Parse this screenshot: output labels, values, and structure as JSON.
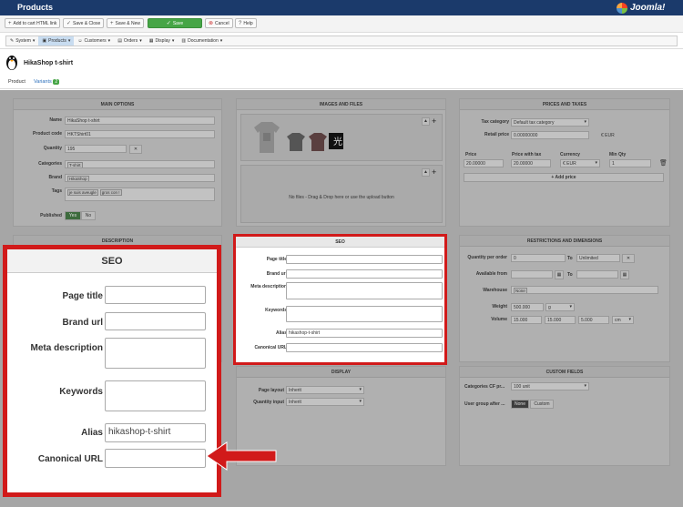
{
  "app": {
    "title": "Products",
    "brand": "Joomla!"
  },
  "toolbar": {
    "add_cart_link": "Add to cart HTML link",
    "save_close": "Save & Close",
    "save_new": "Save & New",
    "save": "Save",
    "cancel": "Cancel",
    "help": "Help"
  },
  "menu": [
    "System",
    "Products",
    "Customers",
    "Orders",
    "Display",
    "Documentation"
  ],
  "product": {
    "name": "HikaShop t-shirt"
  },
  "tabs": {
    "product": "Product",
    "variants": "Variants",
    "variants_count": "2"
  },
  "main_options": {
    "heading": "MAIN OPTIONS",
    "name_label": "Name",
    "name_value": "HikaShop t-shirt",
    "code_label": "Product code",
    "code_value": "HKTShirt01",
    "quantity_label": "Quantity",
    "quantity_value": "195",
    "categories_label": "Categories",
    "categories_tag": "T-shirt",
    "brand_label": "Brand",
    "brand_tag": "HikaShop",
    "tags_label": "Tags",
    "tag1": "je suis aveugle",
    "tag2": "gros con !",
    "published_label": "Published",
    "yes": "Yes",
    "no": "No"
  },
  "images": {
    "heading": "IMAGES AND FILES",
    "no_files": "No files - Drag & Drop here or use the upload button"
  },
  "prices": {
    "heading": "PRICES AND TAXES",
    "tax_label": "Tax category",
    "tax_value": "Default tax category",
    "retail_label": "Retail price",
    "retail_value": "0.00000000",
    "retail_currency": "€ EUR",
    "col_price": "Price",
    "col_price_tax": "Price with tax",
    "col_currency": "Currency",
    "col_min_qty": "Min Qty",
    "price_value": "20.00000",
    "price_tax_value": "20.00000",
    "currency_value": "€ EUR",
    "min_qty_value": "1",
    "add_price": "Add price"
  },
  "description": {
    "heading": "DESCRIPTION"
  },
  "restrictions": {
    "heading": "RESTRICTIONS AND DIMENSIONS",
    "qpo_label": "Quantity per order",
    "qpo_from": "0",
    "qpo_to_label": "To",
    "qpo_to": "Unlimited",
    "avail_label": "Available from",
    "to_label": "To",
    "warehouse_label": "Warehouse",
    "warehouse_tag": "None",
    "weight_label": "Weight",
    "weight_value": "500.000",
    "weight_unit": "g",
    "volume_label": "Volume",
    "v1": "15.000",
    "v2": "15.000",
    "v3": "5.000",
    "volume_unit": "cm"
  },
  "seo": {
    "heading": "SEO",
    "page_title": "Page title",
    "brand_url": "Brand url",
    "meta_description": "Meta description",
    "keywords": "Keywords",
    "alias": "Alias",
    "alias_value": "hikashop-t-shirt",
    "canonical_url": "Canonical URL"
  },
  "display": {
    "heading": "DISPLAY",
    "page_layout_label": "Page layout",
    "page_layout_value": "Inherit",
    "qty_input_label": "Quantity input",
    "qty_input_value": "Inherit"
  },
  "custom_fields": {
    "heading": "CUSTOM FIELDS",
    "cf_label": "Categories CF pr...",
    "cf_value": "100 unit",
    "group_label": "User group after ...",
    "none": "None",
    "custom": "Custom"
  },
  "colors": {
    "highlight": "#d11a1a",
    "topbar": "#1b3a6b",
    "save_green": "#46a546"
  }
}
